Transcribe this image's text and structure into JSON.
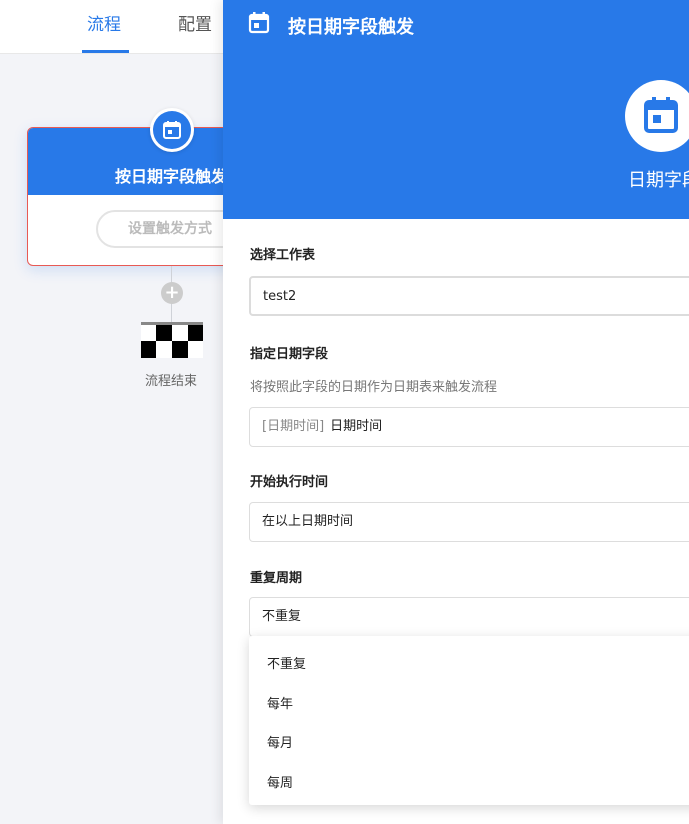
{
  "tabs": {
    "flow": "流程",
    "config": "配置"
  },
  "canvas": {
    "trigger_node": {
      "title": "按日期字段触发",
      "button": "设置触发方式"
    },
    "add_icon": "+",
    "end_label": "流程结束"
  },
  "drawer": {
    "title": "按日期字段触发",
    "hero_label": "日期字段",
    "sections": {
      "table": {
        "label": "选择工作表",
        "value": "test2"
      },
      "date_field": {
        "label": "指定日期字段",
        "description": "将按照此字段的日期作为日期表来触发流程",
        "prefix": "[日期时间]",
        "value": "日期时间"
      },
      "start_time": {
        "label": "开始执行时间",
        "value": "在以上日期时间"
      },
      "repeat": {
        "label": "重复周期",
        "value": "不重复"
      }
    },
    "repeat_options": [
      "不重复",
      "每年",
      "每月",
      "每周"
    ]
  },
  "colors": {
    "accent": "#2879e8",
    "node_border": "#e85a54"
  }
}
